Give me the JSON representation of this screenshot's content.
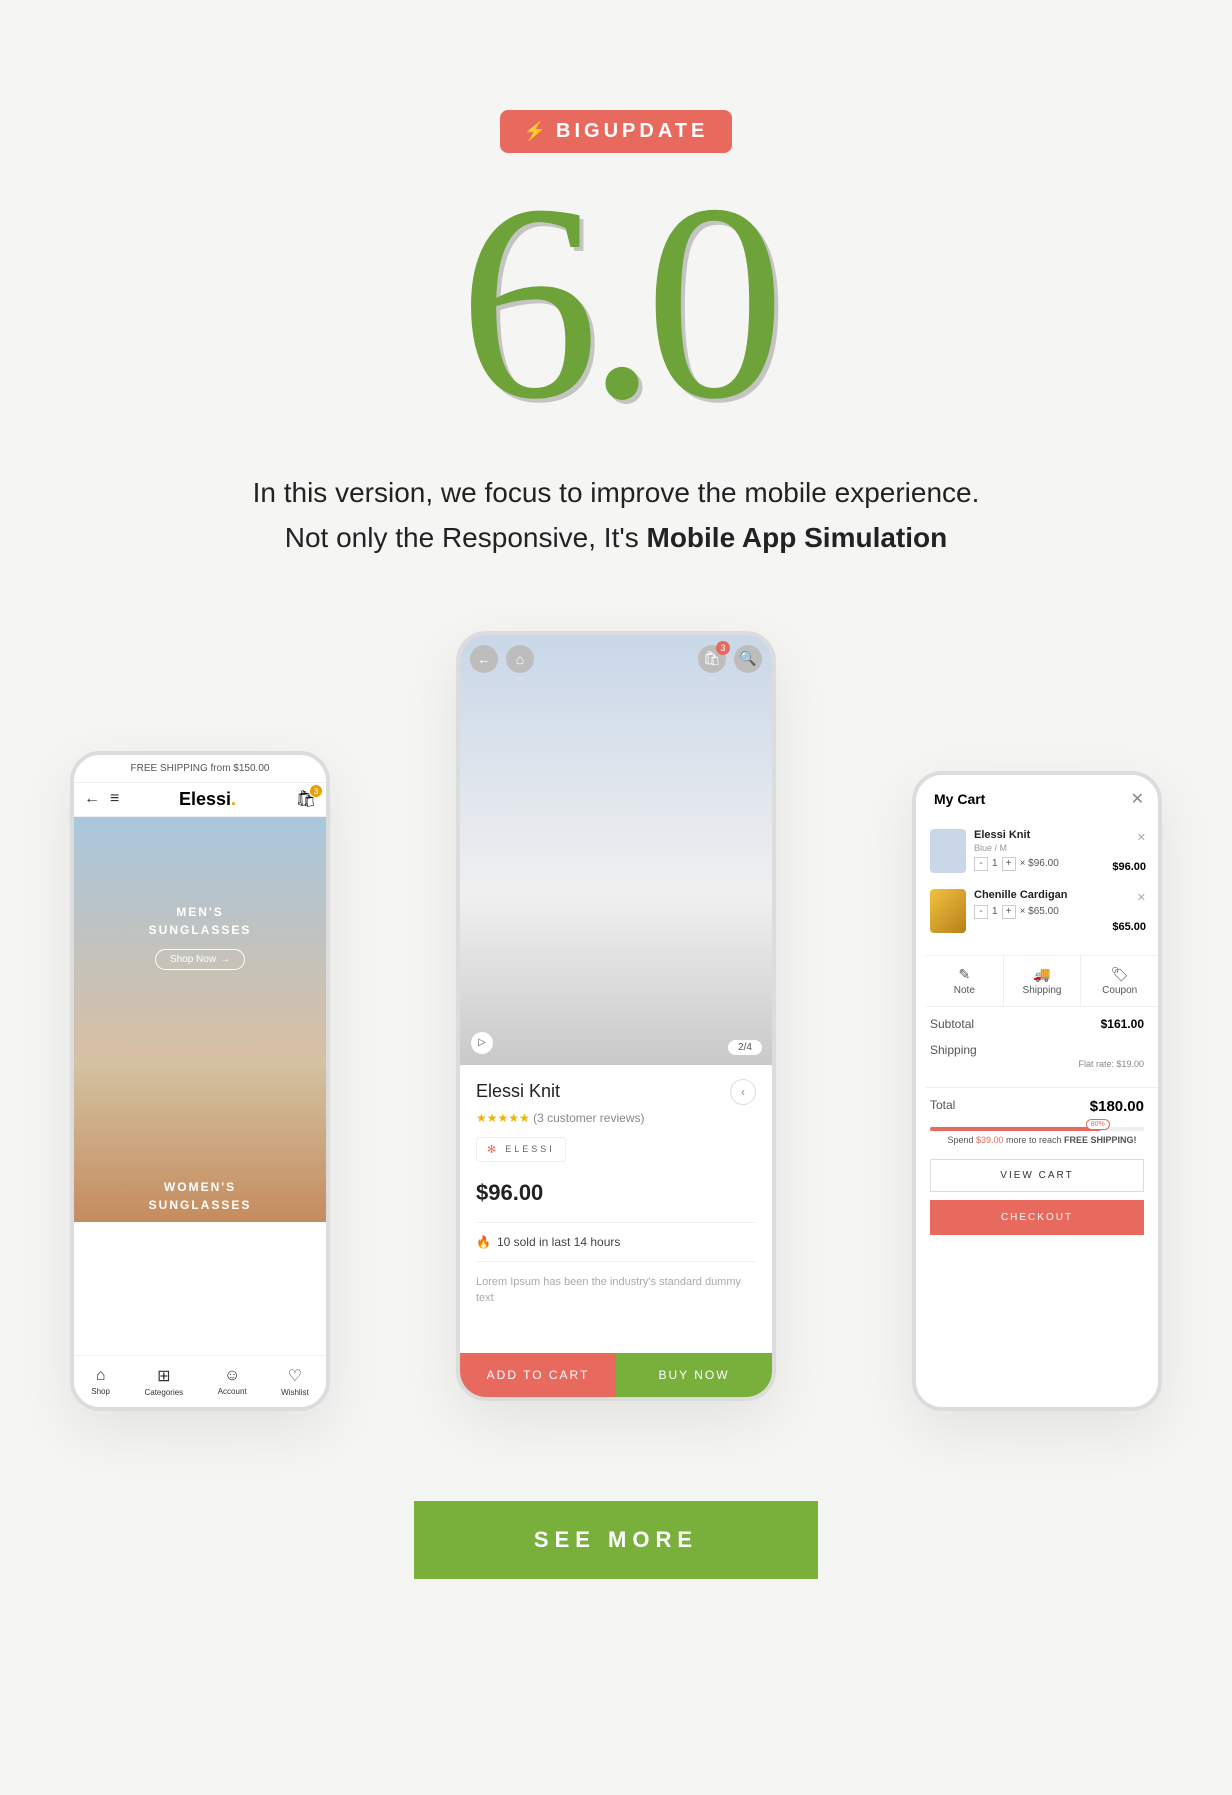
{
  "badge": "BIGUPDATE",
  "version": "6.0",
  "desc_line1": "In this version, we focus to improve the mobile experience.",
  "desc_line2a": "Not only the Responsive, It's ",
  "desc_line2b": "Mobile App Simulation",
  "see_more": "SEE MORE",
  "left": {
    "promo": "FREE SHIPPING from $150.00",
    "brand": "Elessi",
    "bag_count": "3",
    "hero1_line1": "MEN'S",
    "hero1_line2": "SUNGLASSES",
    "shop_now": "Shop Now",
    "hero2_line1": "WOMEN'S",
    "hero2_line2": "SUNGLASSES",
    "nav": {
      "shop": "Shop",
      "categories": "Categories",
      "account": "Account",
      "wishlist": "Wishlist"
    }
  },
  "center": {
    "cart_badge": "3",
    "pager": "2/4",
    "title": "Elessi Knit",
    "reviews": "(3 customer reviews)",
    "brand": "ELESSI",
    "price": "$96.00",
    "sold": "10 sold in last 14 hours",
    "lorem": "Lorem Ipsum has been the industry's standard dummy text",
    "add_to_cart": "ADD TO CART",
    "buy_now": "BUY NOW"
  },
  "cart": {
    "title": "My Cart",
    "items": [
      {
        "name": "Elessi Knit",
        "variant": "Blue / M",
        "qty": "1",
        "unit": "× $96.00",
        "price": "$96.00"
      },
      {
        "name": "Chenille Cardigan",
        "variant": "",
        "qty": "1",
        "unit": "× $65.00",
        "price": "$65.00"
      }
    ],
    "util": {
      "note": "Note",
      "shipping": "Shipping",
      "coupon": "Coupon"
    },
    "subtotal_label": "Subtotal",
    "subtotal": "$161.00",
    "shipping_label": "Shipping",
    "flat_rate": "Flat rate: $19.00",
    "total_label": "Total",
    "total": "$180.00",
    "progress_pct": "80%",
    "ship_msg_a": "Spend ",
    "ship_amount": "$39.00",
    "ship_msg_b": " more to reach ",
    "ship_msg_c": "FREE SHIPPING!",
    "view_cart": "VIEW CART",
    "checkout": "CHECKOUT"
  }
}
